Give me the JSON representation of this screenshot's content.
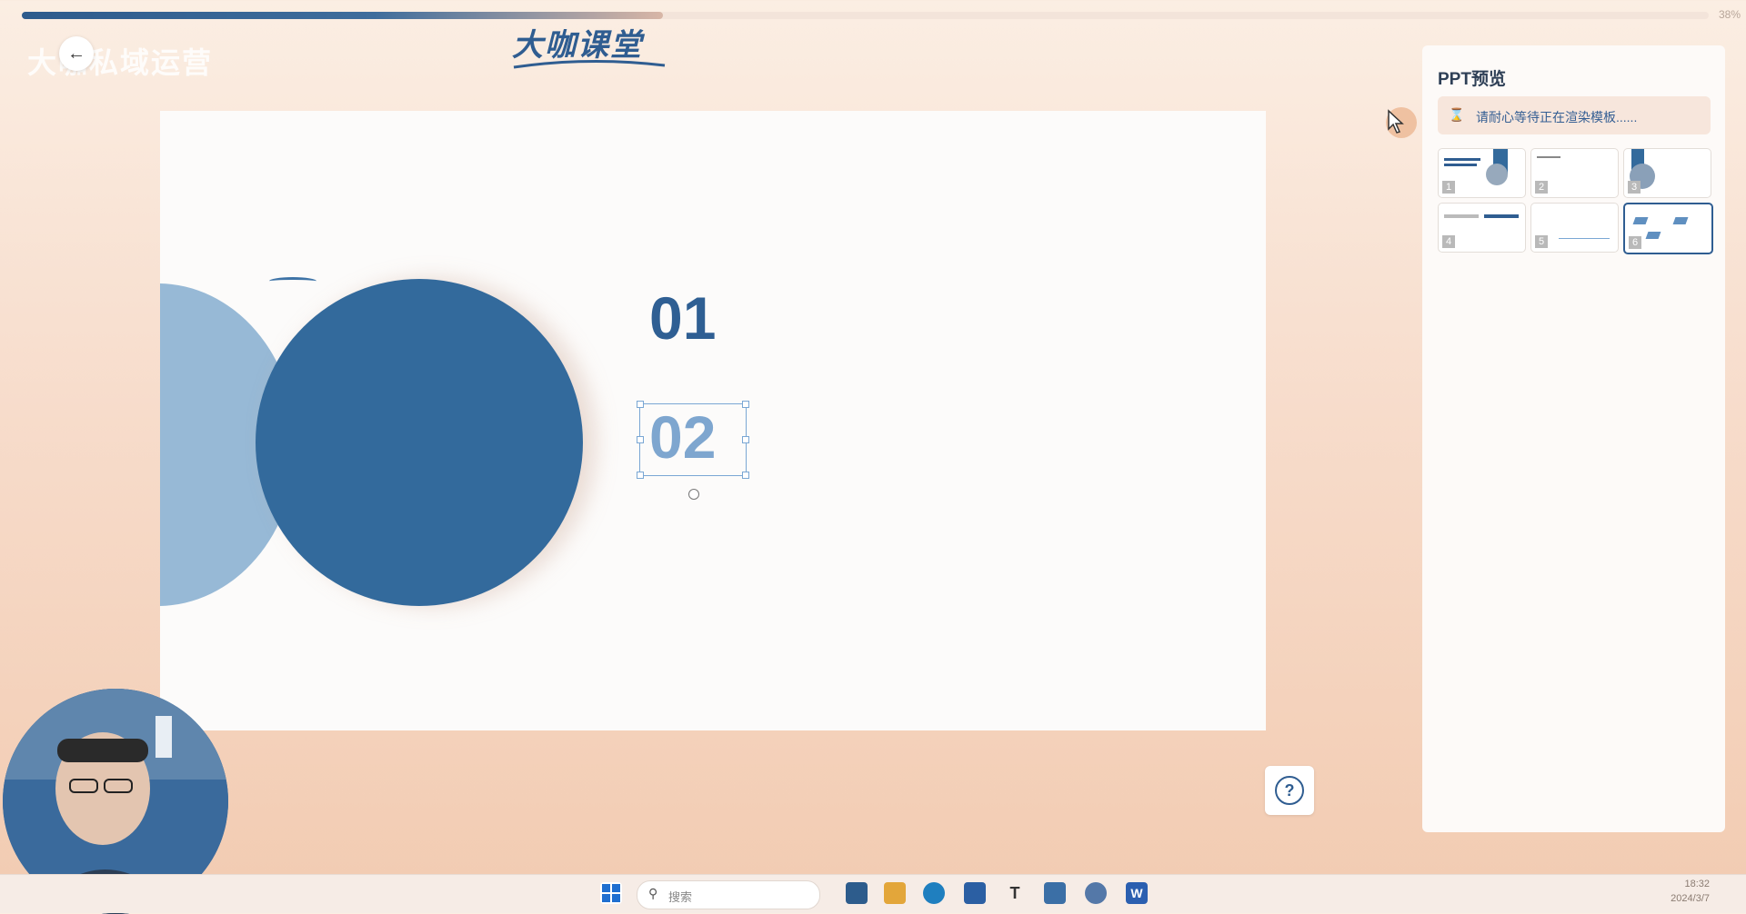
{
  "progress": {
    "percent_text": "38%",
    "fraction": 0.38
  },
  "header": {
    "title": "大咖私域运营",
    "brand": "大咖课堂"
  },
  "slide": {
    "number_1": "01",
    "number_2": "02"
  },
  "panel": {
    "title": "PPT预览",
    "wait_message": "请耐心等待正在渲染模板......",
    "thumbnails": [
      "1",
      "2",
      "3",
      "4",
      "5",
      "6"
    ],
    "active_index": 5
  },
  "taskbar": {
    "search_placeholder": "搜索",
    "time": "18:32",
    "date": "2024/3/7"
  },
  "colors": {
    "accent": "#2f5d91",
    "circle_dark": "#336a9c",
    "circle_light": "#97b9d6"
  }
}
